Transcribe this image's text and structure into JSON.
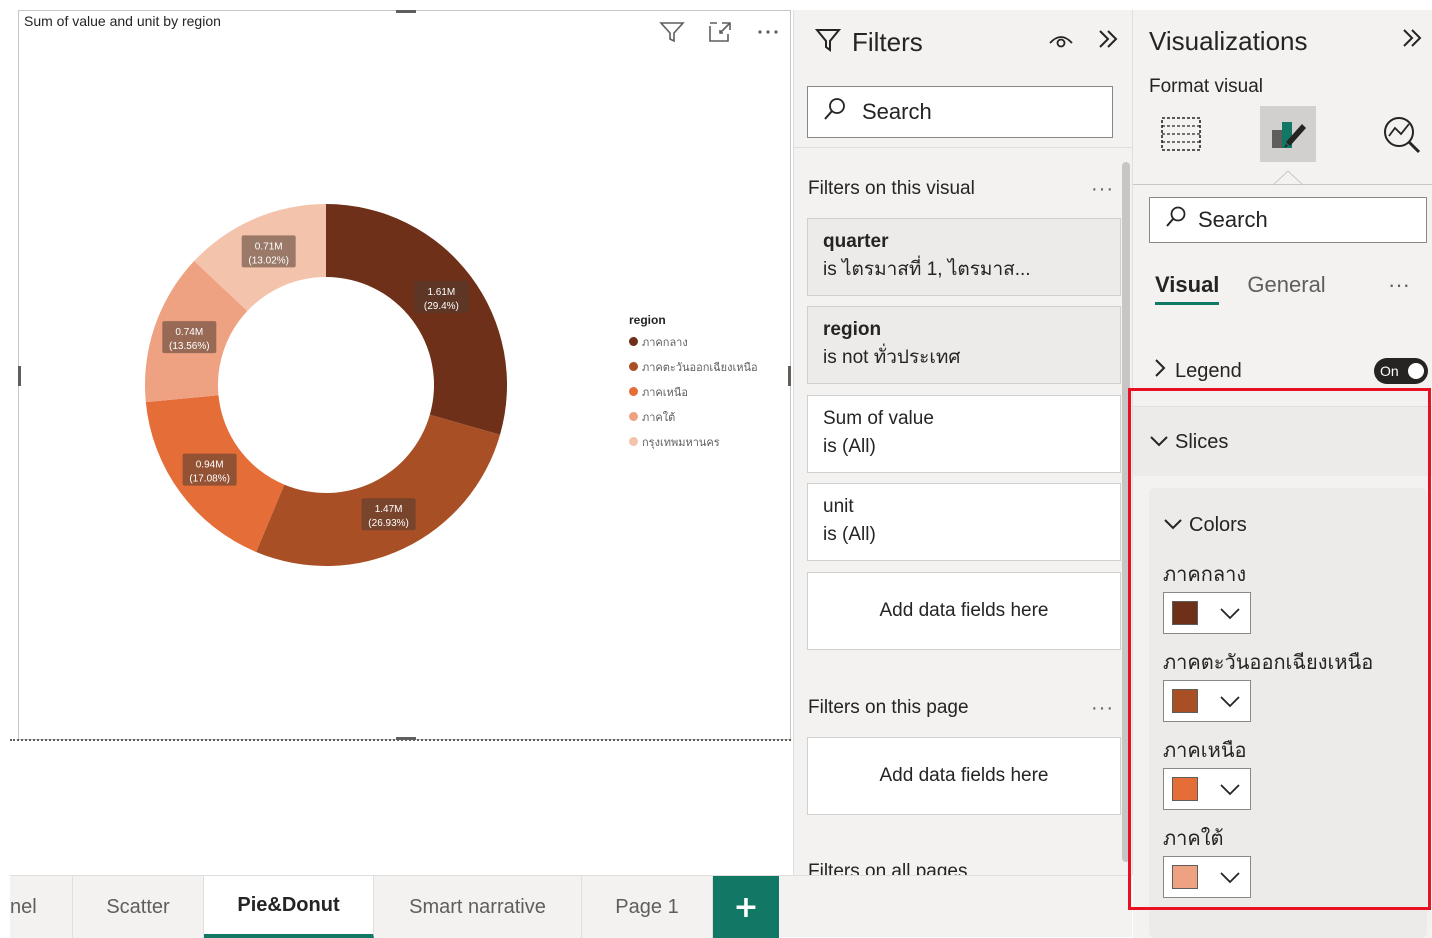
{
  "visual": {
    "title": "Sum of value and unit by region",
    "header_icons": [
      "filter-icon",
      "focus-mode-icon",
      "more-options-icon"
    ]
  },
  "chart_data": {
    "type": "donut",
    "title": "Sum of value and unit by region",
    "categories": [
      "ภาคกลาง",
      "ภาคตะวันออกเฉียงเหนือ",
      "ภาคเหนือ",
      "ภาคใต้",
      "กรุงเทพมหานคร"
    ],
    "values": [
      1.61,
      1.47,
      0.94,
      0.74,
      0.71
    ],
    "value_unit": "M",
    "percents": [
      29.4,
      26.93,
      17.08,
      13.56,
      13.02
    ],
    "data_labels": [
      {
        "value": "1.61M",
        "pct": "(29.4%)"
      },
      {
        "value": "1.47M",
        "pct": "(26.93%)"
      },
      {
        "value": "0.94M",
        "pct": "(17.08%)"
      },
      {
        "value": "0.74M",
        "pct": "(13.56%)"
      },
      {
        "value": "0.71M",
        "pct": "(13.02%)"
      }
    ],
    "colors": [
      "#6E3018",
      "#A84F25",
      "#E46D38",
      "#EFA282",
      "#F4C3AC"
    ],
    "legend": {
      "title": "region",
      "placement": "right"
    }
  },
  "filters_pane": {
    "title": "Filters",
    "search_placeholder": "Search",
    "on_this_visual": "Filters on this visual",
    "more": "···",
    "cards": [
      {
        "name": "quarter",
        "desc": "is ไตรมาสที่ 1, ไตรมาส..."
      },
      {
        "name": "region",
        "desc": "is not ทั่วประเทศ"
      },
      {
        "name": "Sum of value",
        "desc": "is (All)"
      },
      {
        "name": "unit",
        "desc": "is (All)"
      }
    ],
    "add_fields": "Add data fields here",
    "on_this_page": "Filters on this page",
    "add_fields_page": "Add data fields here",
    "on_all_pages": "Filters on all pages"
  },
  "viz_pane": {
    "title": "Visualizations",
    "subtitle": "Format visual",
    "search_placeholder": "Search",
    "tabs": [
      "Visual",
      "General"
    ],
    "more": "···",
    "legend_label": "Legend",
    "legend_toggle": "On",
    "slices_label": "Slices",
    "colors_label": "Colors",
    "color_items": [
      {
        "label": "ภาคกลาง",
        "color": "#6E3018"
      },
      {
        "label": "ภาคตะวันออกเฉียงเหนือ",
        "color": "#A84F25"
      },
      {
        "label": "ภาคเหนือ",
        "color": "#E46D38"
      },
      {
        "label": "ภาคใต้",
        "color": "#EFA282"
      }
    ]
  },
  "page_tabs": {
    "items": [
      "nel",
      "Scatter",
      "Pie&Donut",
      "Smart narrative",
      "Page 1"
    ],
    "active": "Pie&Donut",
    "add": "+"
  },
  "colors": {
    "accent": "#117865",
    "highlight": "#E81123"
  }
}
